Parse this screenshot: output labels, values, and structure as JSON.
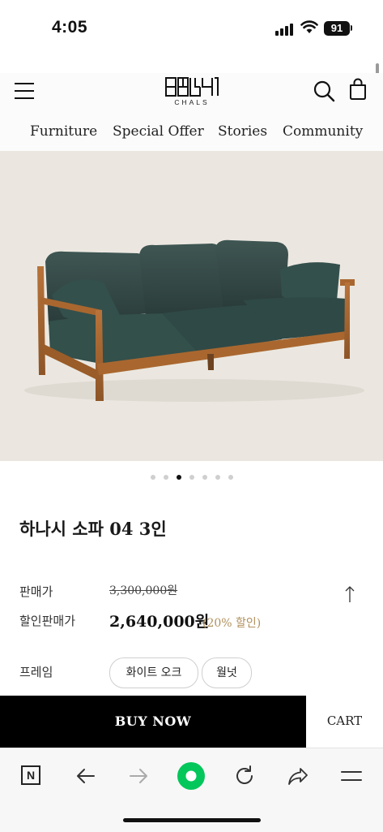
{
  "status_bar": {
    "time": "4:05",
    "battery": "91"
  },
  "header": {
    "logo_text": "CHALS"
  },
  "nav": {
    "items": [
      {
        "label": "Furniture"
      },
      {
        "label": "Special Offer"
      },
      {
        "label": "Stories"
      },
      {
        "label": "Community"
      }
    ]
  },
  "carousel": {
    "total_slides": 7,
    "active_slide": 3
  },
  "product": {
    "title": "하나시 소파 04 3인",
    "price_label": "판매가",
    "original_price": "3,300,000원",
    "sale_label": "할인판매가",
    "sale_price": "2,640,000원",
    "discount_text": "(20% 할인)",
    "frame_label": "프레임",
    "frame_options": [
      {
        "label": "화이트 오크"
      },
      {
        "label": "월넛"
      }
    ]
  },
  "actions": {
    "buy_now": "BUY NOW",
    "cart": "CART"
  },
  "browser_toolbar": {
    "n_icon_letter": "N"
  },
  "colors": {
    "accent_discount": "#b0905c",
    "buy_button_bg": "#000000",
    "browser_green": "#03c75a",
    "hero_bg": "#ebe7e0"
  },
  "icons": {
    "menu": "hamburger-icon",
    "search": "search-icon",
    "bag": "shopping-bag-icon",
    "scroll_top": "arrow-up-icon",
    "back": "arrow-left-icon",
    "forward": "arrow-right-icon",
    "home": "green-dot-icon",
    "refresh": "refresh-icon",
    "share": "share-icon",
    "more": "menu-icon"
  }
}
